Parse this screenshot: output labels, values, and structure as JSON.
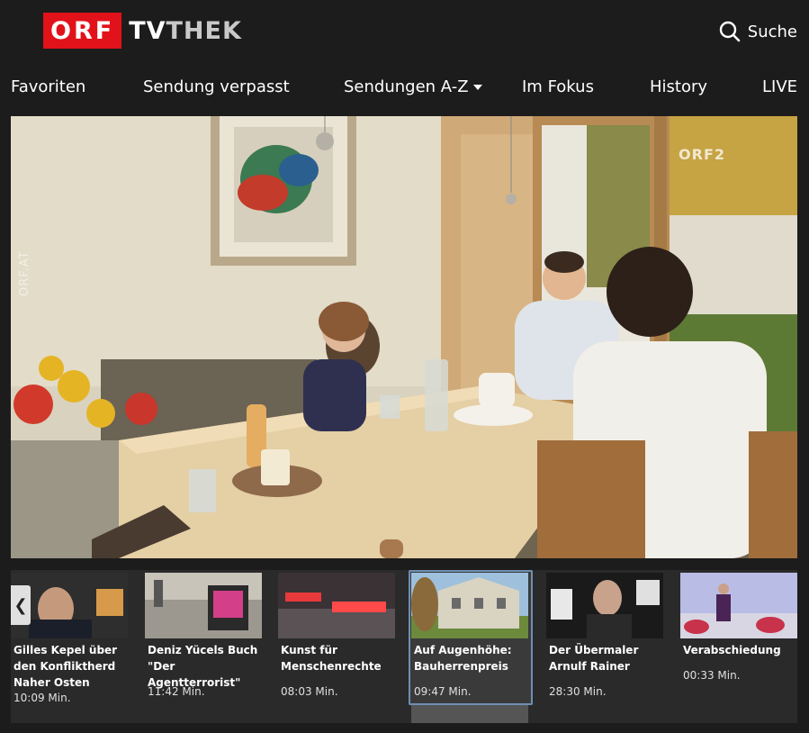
{
  "header": {
    "logo_orf": "ORF",
    "logo_tv": "TV",
    "logo_thek": "THEK",
    "search_label": "Suche"
  },
  "nav": {
    "items": [
      {
        "label": "Favoriten"
      },
      {
        "label": "Sendung verpasst"
      },
      {
        "label": "Sendungen A-Z"
      },
      {
        "label": "Im Fokus"
      },
      {
        "label": "History"
      },
      {
        "label": "LIVE"
      }
    ]
  },
  "video": {
    "watermark_channel": "ORF2",
    "watermark_side": "ORF.AT"
  },
  "carousel": {
    "prev_label": "❮",
    "items": [
      {
        "title": "Gilles Kepel über den Konfliktherd Naher Osten",
        "duration": "10:09 Min."
      },
      {
        "title": "Deniz Yücels Buch \"Der Agentterrorist\"",
        "duration": "11:42 Min."
      },
      {
        "title": "Kunst für Menschenrechte",
        "duration": "08:03 Min."
      },
      {
        "title": "Auf Augenhöhe: Bauherrenpreis",
        "duration": "09:47 Min."
      },
      {
        "title": "Der Übermaler Arnulf Rainer",
        "duration": "28:30 Min."
      },
      {
        "title": "Verabschiedung",
        "duration": "00:33 Min."
      }
    ]
  },
  "colors": {
    "brand_red": "#e1121a",
    "background": "#1c1c1c",
    "active_border": "#6f8fb3"
  }
}
